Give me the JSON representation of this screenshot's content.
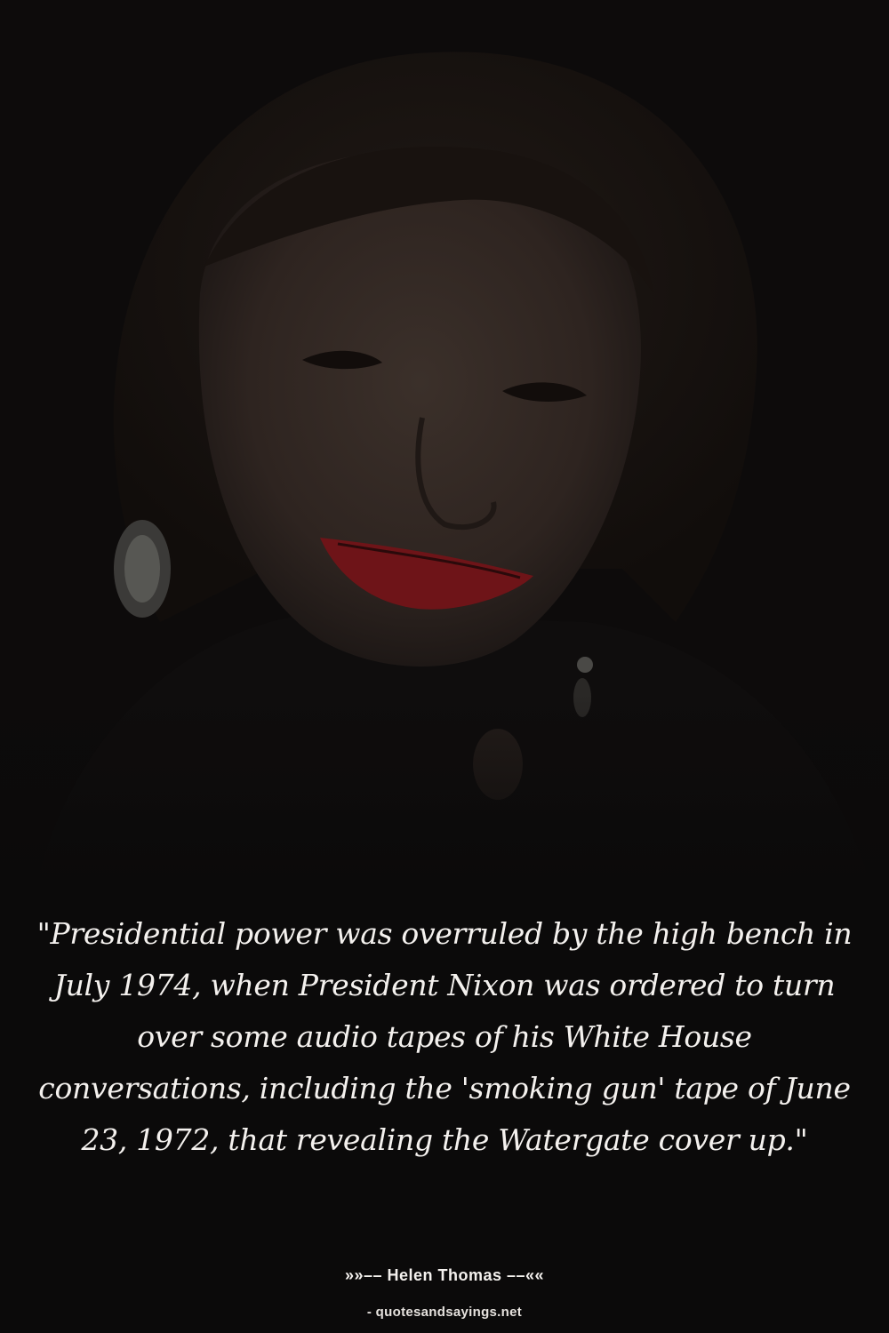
{
  "photo": {
    "subject": "smiling woman portrait",
    "background_color": "#0b0a0a",
    "hair_color": "#1a1512",
    "skin_color": "#342a25",
    "lip_color": "#6e1418",
    "earring_color": "#6b6a66"
  },
  "quote": {
    "text": "\"Presidential power was overruled by the high bench in July 1974, when President Nixon was ordered to turn over some audio tapes of his White House conversations, including the 'smoking gun' tape of June 23, 1972, that revealing the Watergate cover up.\""
  },
  "author": {
    "line": "»»–– Helen Thomas ––««"
  },
  "source": {
    "line": "- quotesandsayings.net"
  }
}
